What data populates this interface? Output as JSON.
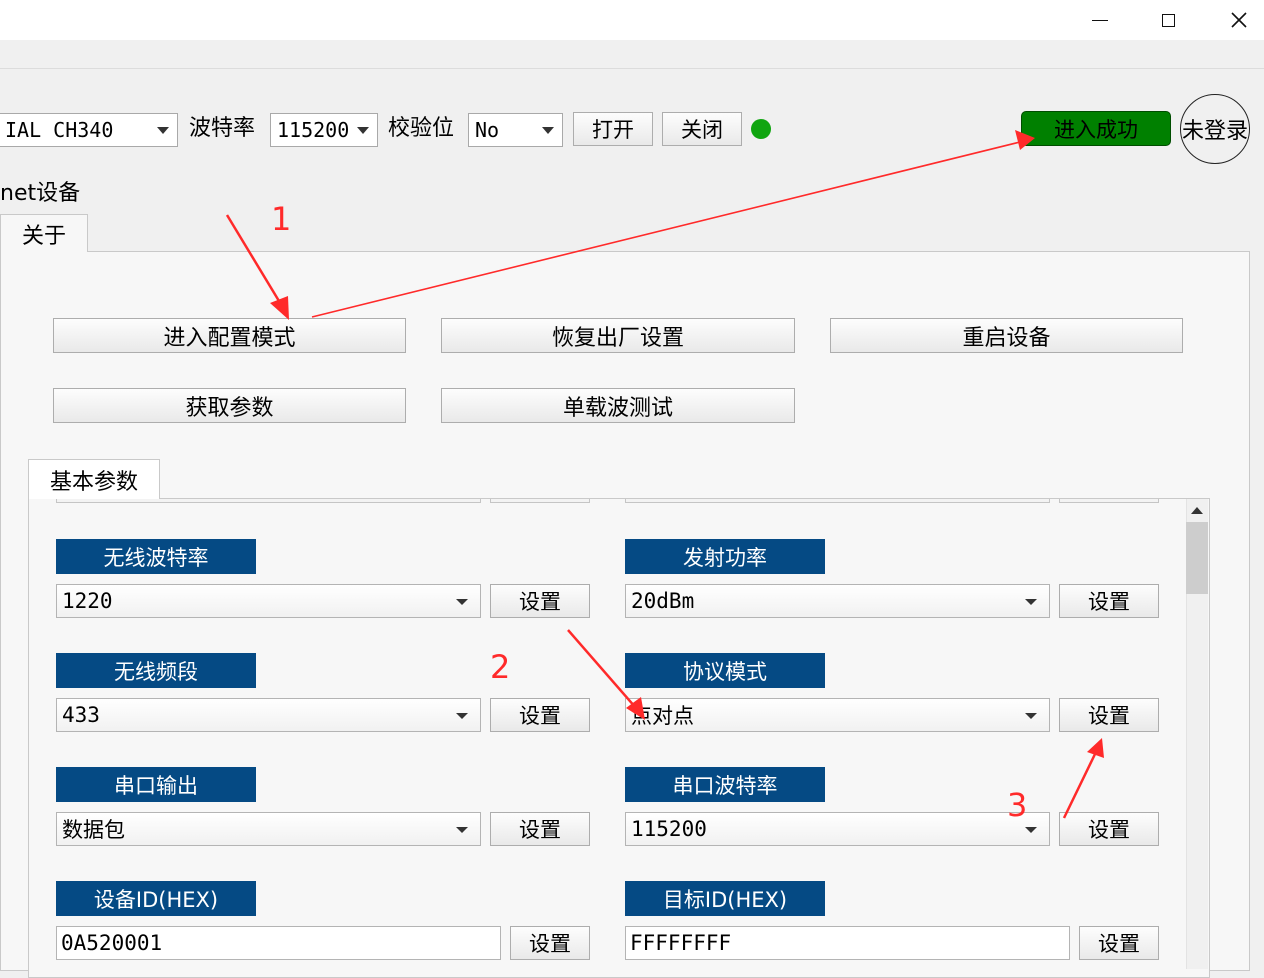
{
  "window_controls": {
    "minimize": "minimize-icon",
    "maximize": "maximize-icon",
    "close": "close-icon"
  },
  "toolbar": {
    "port_value": "IAL CH340",
    "baud_label": "波特率",
    "baud_value": "115200",
    "parity_label": "校验位",
    "parity_value": "No",
    "open_label": "打开",
    "close_label": "关闭",
    "status_color": "#10a510",
    "success_label": "进入成功",
    "login_label": "未登录"
  },
  "device_label": "net设备",
  "tabs": {
    "about": "关于",
    "basic_params": "基本参数"
  },
  "actions": {
    "enter_config": "进入配置模式",
    "restore_factory": "恢复出厂设置",
    "restart": "重启设备",
    "get_params": "获取参数",
    "single_carrier": "单载波测试"
  },
  "params": {
    "wireless_baud": {
      "label": "无线波特率",
      "value": "1220",
      "set": "设置"
    },
    "tx_power": {
      "label": "发射功率",
      "value": "20dBm",
      "set": "设置"
    },
    "wireless_band": {
      "label": "无线频段",
      "value": "433",
      "set": "设置"
    },
    "protocol_mode": {
      "label": "协议模式",
      "value": "点对点",
      "set": "设置"
    },
    "serial_output": {
      "label": "串口输出",
      "value": "数据包",
      "set": "设置"
    },
    "serial_baud": {
      "label": "串口波特率",
      "value": "115200",
      "set": "设置"
    },
    "device_id": {
      "label": "设备ID(HEX)",
      "value": "0A520001",
      "set": "设置"
    },
    "target_id": {
      "label": "目标ID(HEX)",
      "value": "FFFFFFFF",
      "set": "设置"
    }
  },
  "annotations": {
    "a1": "1",
    "a2": "2",
    "a3": "3",
    "color": "#ff2a2a"
  },
  "colors": {
    "header_blue": "#054a84",
    "success_green": "#008000"
  }
}
